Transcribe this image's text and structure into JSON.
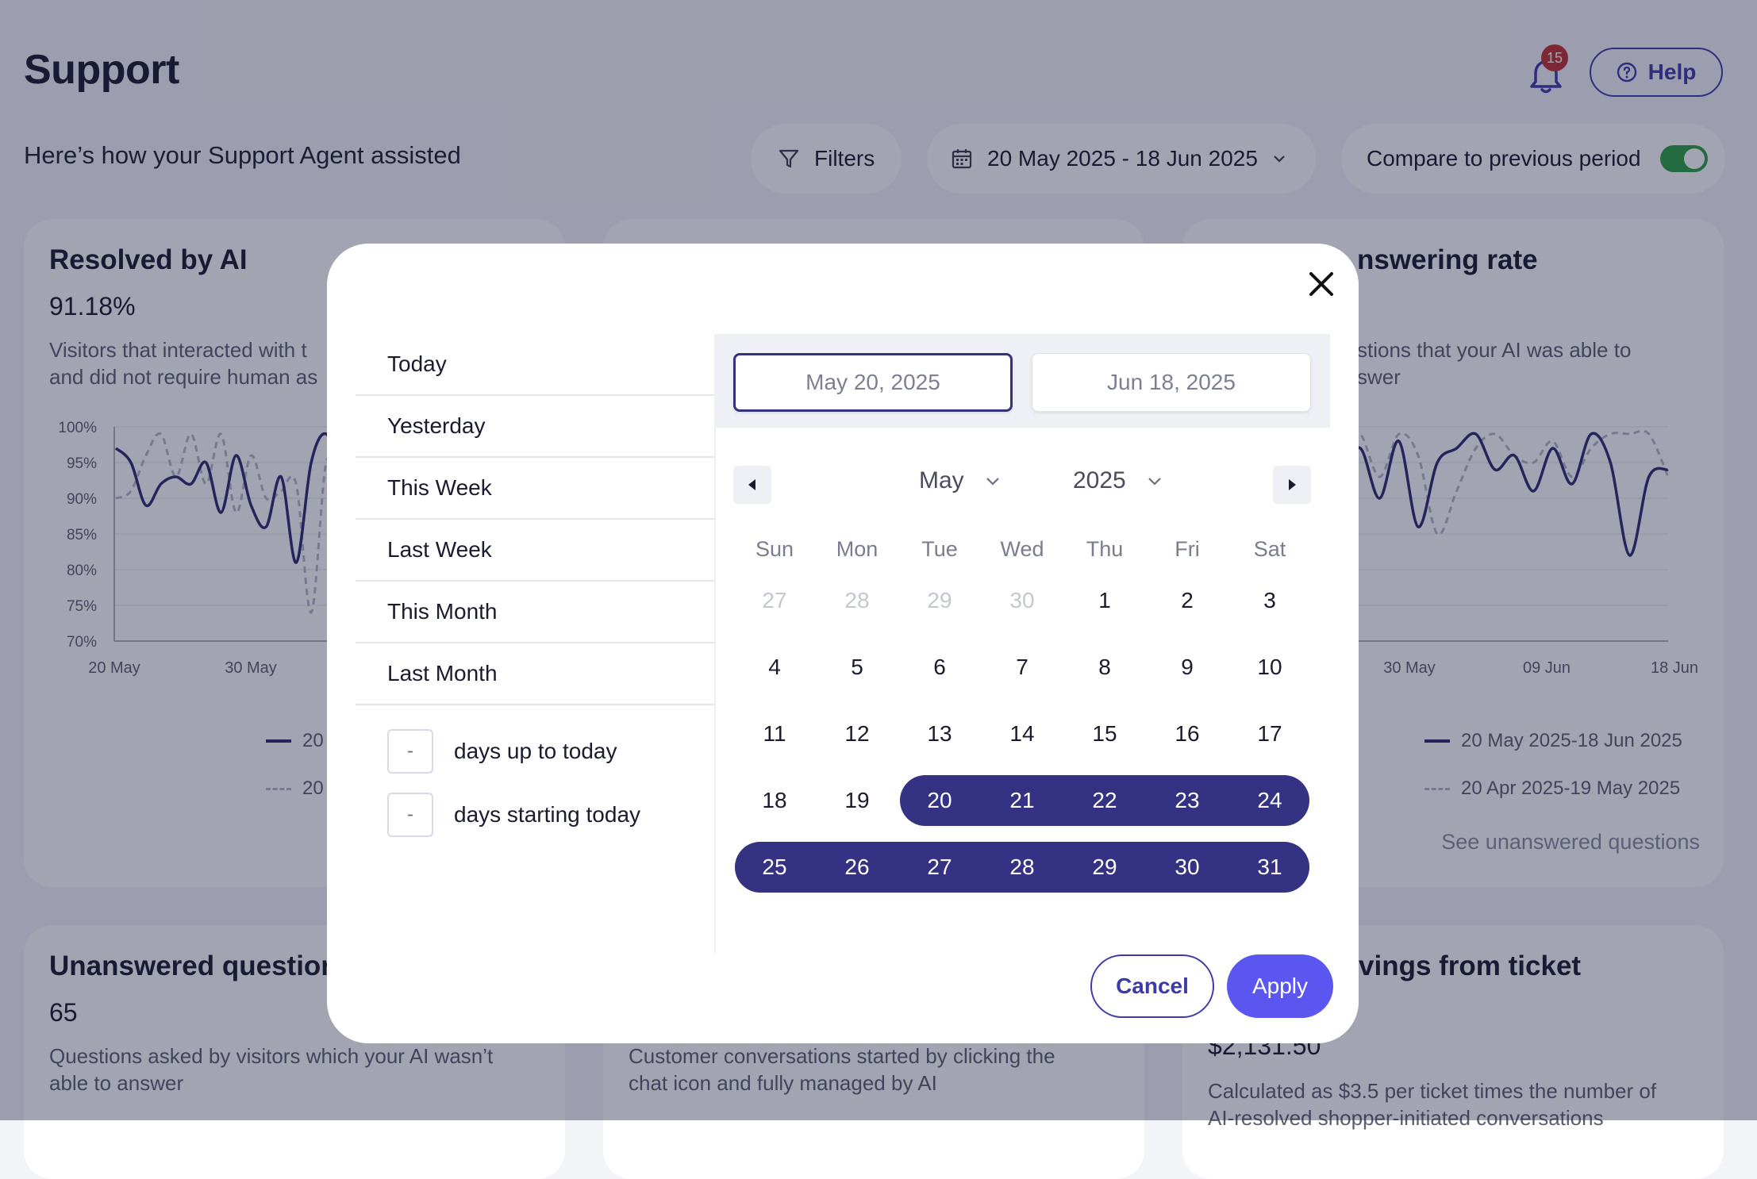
{
  "header": {
    "title": "Support",
    "subtitle": "Here’s how your Support Agent assisted",
    "notification_count": "15",
    "help_label": "Help"
  },
  "toolbar": {
    "filters_label": "Filters",
    "date_range_label": "20 May 2025 - 18 Jun 2025",
    "compare_label": "Compare to previous period",
    "compare_enabled": true
  },
  "cards": {
    "resolved": {
      "title": "Resolved by AI",
      "value": "91.18%",
      "desc_line1": "Visitors that interacted with t",
      "desc_line2": "and did not require human as",
      "legend_current": "20",
      "legend_previous": "20"
    },
    "answering": {
      "title": "nswering rate",
      "desc_line1": "stions that your AI was able to",
      "desc_line2": "swer",
      "legend_current": "20 May 2025-18 Jun 2025",
      "legend_previous": "20 Apr 2025-19 May 2025",
      "link": "See unanswered questions"
    },
    "unanswered": {
      "title": "Unanswered question",
      "value": "65",
      "desc_line1": "Questions asked by visitors which your AI wasn’t",
      "desc_line2": "able to answer"
    },
    "conversations": {
      "desc_line1": "Customer conversations started by clicking the",
      "desc_line2": "chat icon and fully managed by AI"
    },
    "savings": {
      "title": "vings from ticket",
      "value": "$2,131.50",
      "desc_line1": "Calculated as $3.5 per ticket times the number of",
      "desc_line2": "AI-resolved shopper-initiated conversations"
    }
  },
  "chart_data": [
    {
      "type": "line",
      "title": "Resolved by AI",
      "y_ticks": [
        "100%",
        "95%",
        "90%",
        "85%",
        "80%",
        "75%",
        "70%"
      ],
      "ylim": [
        70,
        100
      ],
      "x_ticks": [
        "20 May",
        "30 May"
      ],
      "series": [
        {
          "name": "20 May 2025-18 Jun 2025",
          "style": "solid",
          "color": "#2e2b6e",
          "values": [
            97,
            95,
            89,
            92,
            93,
            92,
            95,
            88,
            96,
            89,
            86,
            93,
            81,
            95,
            99,
            93
          ]
        },
        {
          "name": "20 Apr 2025-19 May 2025",
          "style": "dashed",
          "color": "#b5b8c6",
          "values": [
            90,
            91,
            96,
            99,
            93,
            99,
            92,
            99,
            88,
            96,
            90,
            91,
            92,
            74,
            95,
            91
          ]
        }
      ]
    },
    {
      "type": "line",
      "title": "Answering rate",
      "x_ticks": [
        "30 May",
        "09 Jun",
        "18 Jun"
      ],
      "series": [
        {
          "name": "20 May 2025-18 Jun 2025",
          "style": "solid",
          "color": "#2e2b6e",
          "values": [
            94,
            97,
            90,
            98,
            86,
            95,
            97,
            99,
            94,
            96,
            91,
            97,
            92,
            99,
            95,
            82,
            93,
            94
          ]
        },
        {
          "name": "20 Apr 2025-19 May 2025",
          "style": "dashed",
          "color": "#b5b8c6",
          "values": [
            99,
            99,
            93,
            99,
            96,
            85,
            91,
            97,
            99,
            96,
            95,
            98,
            93,
            97,
            99,
            99,
            99,
            93
          ]
        }
      ]
    }
  ],
  "modal": {
    "presets": [
      "Today",
      "Yesterday",
      "This Week",
      "Last Week",
      "This Month",
      "Last Month"
    ],
    "days_up_to_today": {
      "value": "-",
      "label": "days up to today"
    },
    "days_starting_today": {
      "value": "-",
      "label": "days starting today"
    },
    "start_date": "May 20, 2025",
    "end_date": "Jun 18, 2025",
    "month": "May",
    "year": "2025",
    "weekdays": [
      "Sun",
      "Mon",
      "Tue",
      "Wed",
      "Thu",
      "Fri",
      "Sat"
    ],
    "weeks": [
      [
        {
          "d": "27",
          "state": "muted"
        },
        {
          "d": "28",
          "state": "muted"
        },
        {
          "d": "29",
          "state": "muted"
        },
        {
          "d": "30",
          "state": "muted"
        },
        {
          "d": "1",
          "state": "normal"
        },
        {
          "d": "2",
          "state": "normal"
        },
        {
          "d": "3",
          "state": "normal"
        }
      ],
      [
        {
          "d": "4",
          "state": "normal"
        },
        {
          "d": "5",
          "state": "normal"
        },
        {
          "d": "6",
          "state": "normal"
        },
        {
          "d": "7",
          "state": "normal"
        },
        {
          "d": "8",
          "state": "normal"
        },
        {
          "d": "9",
          "state": "normal"
        },
        {
          "d": "10",
          "state": "normal"
        }
      ],
      [
        {
          "d": "11",
          "state": "normal"
        },
        {
          "d": "12",
          "state": "normal"
        },
        {
          "d": "13",
          "state": "normal"
        },
        {
          "d": "14",
          "state": "normal"
        },
        {
          "d": "15",
          "state": "normal"
        },
        {
          "d": "16",
          "state": "normal"
        },
        {
          "d": "17",
          "state": "normal"
        }
      ],
      [
        {
          "d": "18",
          "state": "normal"
        },
        {
          "d": "19",
          "state": "normal"
        },
        {
          "d": "20",
          "state": "selected"
        },
        {
          "d": "21",
          "state": "selected"
        },
        {
          "d": "22",
          "state": "selected"
        },
        {
          "d": "23",
          "state": "selected"
        },
        {
          "d": "24",
          "state": "selected"
        }
      ],
      [
        {
          "d": "25",
          "state": "selected"
        },
        {
          "d": "26",
          "state": "selected"
        },
        {
          "d": "27",
          "state": "selected"
        },
        {
          "d": "28",
          "state": "selected"
        },
        {
          "d": "29",
          "state": "selected"
        },
        {
          "d": "30",
          "state": "selected"
        },
        {
          "d": "31",
          "state": "selected"
        }
      ]
    ],
    "cancel_label": "Cancel",
    "apply_label": "Apply"
  },
  "colors": {
    "accent": "#3d3aa9",
    "range_selected": "#353283",
    "apply_button": "#5b56f0",
    "toggle_on": "#2ea043",
    "badge": "#c03131"
  }
}
